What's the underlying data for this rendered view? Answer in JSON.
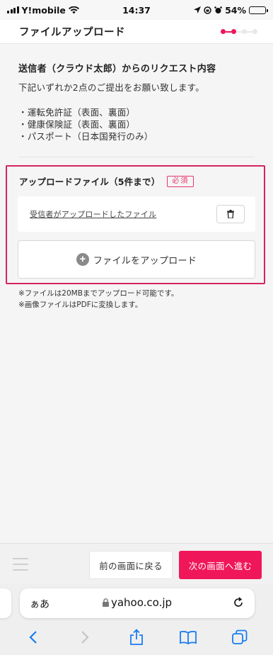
{
  "status_bar": {
    "carrier": "Y!mobile",
    "time": "14:37",
    "battery": "54%",
    "battery_level": 0.54
  },
  "header": {
    "title": "ファイルアップロード",
    "step_current": 1,
    "step_total": 3
  },
  "request": {
    "title": "送信者（クラウド太郎）からのリクエスト内容",
    "description": "下記いずれか2点のご提出をお願い致します。",
    "documents": [
      "・運転免許証（表面、裏面）",
      "・健康保険証（表面、裏面）",
      "・パスポート（日本国発行のみ）"
    ]
  },
  "upload": {
    "label": "アップロードファイル（5件まで）",
    "required_badge": "必須",
    "uploaded_file": "受信者がアップロードしたファイル",
    "upload_button": "ファイルをアップロード"
  },
  "notes": [
    "※ファイルは20MBまでアップロード可能です。",
    "※画像ファイルはPDFに変換します。"
  ],
  "footer": {
    "back_label": "前の画面に戻る",
    "next_label": "次の画面へ進む"
  },
  "browser": {
    "aa_label": "ぁあ",
    "url": "yahoo.co.jp"
  },
  "colors": {
    "accent": "#f0165a",
    "border_highlight": "#d6245f"
  }
}
